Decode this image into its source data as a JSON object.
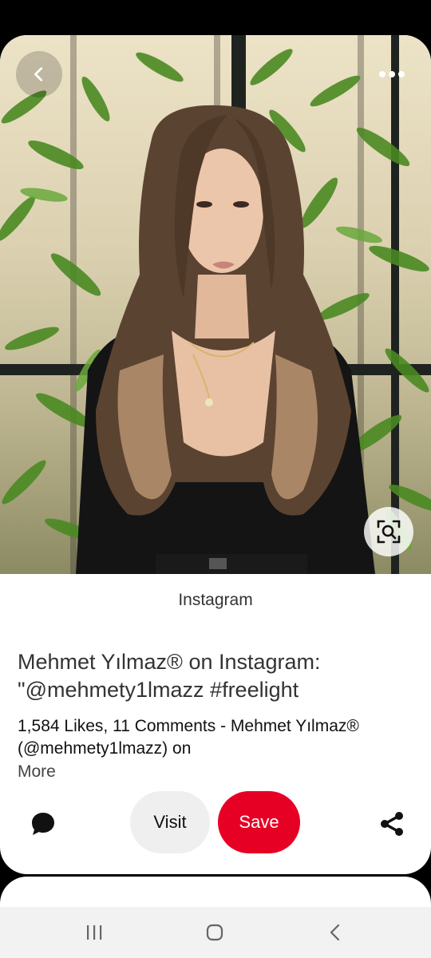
{
  "pin": {
    "source": "Instagram",
    "title": "Mehmet Yılmaz® on Instagram: \"@mehmety1lmazz  #freelight",
    "description": "1,584 Likes, 11 Comments - Mehmet Yılmaz® (@mehmety1lmazz) on",
    "more_label": "More"
  },
  "actions": {
    "visit_label": "Visit",
    "save_label": "Save"
  },
  "icons": {
    "back": "chevron-left-icon",
    "more": "more-horizontal-icon",
    "lens": "visual-search-icon",
    "comment": "comment-bubble-icon",
    "share": "share-icon",
    "nav_recents": "recents-icon",
    "nav_home": "home-icon",
    "nav_back": "back-icon"
  },
  "colors": {
    "save_button": "#e60023",
    "visit_button": "#efefef",
    "background": "#000000",
    "card": "#ffffff"
  }
}
